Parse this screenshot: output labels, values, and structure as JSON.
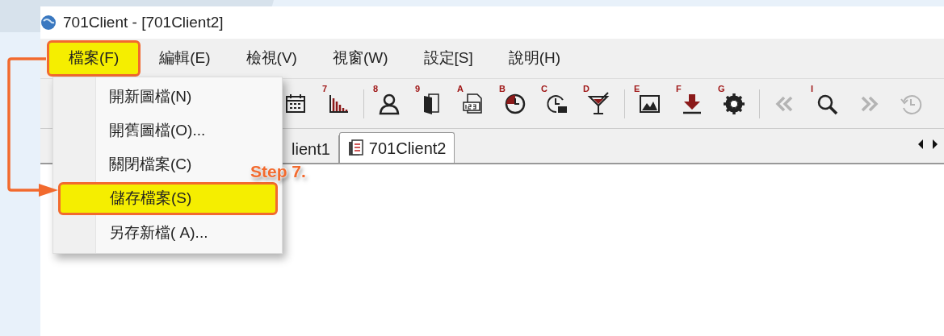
{
  "window": {
    "title": "701Client - [701Client2]"
  },
  "menu_bar": [
    {
      "label": "檔案(F)",
      "highlighted": true
    },
    {
      "label": "編輯(E)",
      "highlighted": false
    },
    {
      "label": "檢視(V)",
      "highlighted": false
    },
    {
      "label": "視窗(W)",
      "highlighted": false
    },
    {
      "label": "設定[S]",
      "highlighted": false
    },
    {
      "label": "說明(H)",
      "highlighted": false
    }
  ],
  "file_menu": [
    {
      "label": "開新圖檔(N)",
      "highlighted": false
    },
    {
      "label": "開舊圖檔(O)...",
      "highlighted": false
    },
    {
      "label": "關閉檔案(C)",
      "highlighted": false
    },
    {
      "label": "儲存檔案(S)",
      "highlighted": true
    },
    {
      "label": "另存新檔( A)...",
      "highlighted": false
    }
  ],
  "toolbar": [
    {
      "kind": "calendar",
      "disabled": false
    },
    {
      "kind": "bars",
      "badge": "7",
      "disabled": false
    },
    {
      "kind": "separator"
    },
    {
      "kind": "person",
      "badge": "8",
      "disabled": false
    },
    {
      "kind": "door",
      "badge": "9",
      "disabled": false
    },
    {
      "kind": "numbers",
      "badge": "A",
      "disabled": false
    },
    {
      "kind": "clock",
      "badge": "B",
      "disabled": false
    },
    {
      "kind": "clock-bag",
      "badge": "C",
      "disabled": false
    },
    {
      "kind": "glass",
      "badge": "D",
      "disabled": false
    },
    {
      "kind": "separator"
    },
    {
      "kind": "picture",
      "badge": "E",
      "disabled": false
    },
    {
      "kind": "download",
      "badge": "F",
      "disabled": false
    },
    {
      "kind": "gear",
      "badge": "G",
      "disabled": false
    },
    {
      "kind": "separator"
    },
    {
      "kind": "back",
      "disabled": true
    },
    {
      "kind": "search",
      "badge": "I",
      "disabled": false
    },
    {
      "kind": "forward",
      "disabled": true
    },
    {
      "kind": "history",
      "disabled": true
    }
  ],
  "tabs": [
    {
      "label": "lient1",
      "selected": false
    },
    {
      "label": "701Client2",
      "selected": true
    }
  ],
  "annotation": {
    "label": "Step 7."
  }
}
